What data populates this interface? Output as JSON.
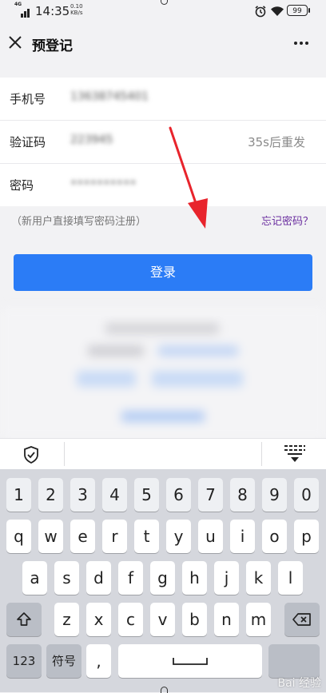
{
  "status_bar": {
    "network": "4G",
    "time": "14:35",
    "speed_value": "0.10",
    "speed_unit": "KB/s",
    "battery": "99"
  },
  "nav": {
    "title": "预登记",
    "close_icon": "close-icon",
    "more_icon": "more-icon"
  },
  "form": {
    "phone": {
      "label": "手机号",
      "value": "13638745401"
    },
    "code": {
      "label": "验证码",
      "value": "223945",
      "resend": "35s后重发"
    },
    "password": {
      "label": "密码",
      "value": "••••••••••"
    }
  },
  "hint": "（新用户直接填写密码注册）",
  "forgot": "忘记密码？",
  "login_button": "登录",
  "keyboard": {
    "numbers": [
      "1",
      "2",
      "3",
      "4",
      "5",
      "6",
      "7",
      "8",
      "9",
      "0"
    ],
    "row1": [
      "q",
      "w",
      "e",
      "r",
      "t",
      "y",
      "u",
      "i",
      "o",
      "p"
    ],
    "row2": [
      "a",
      "s",
      "d",
      "f",
      "g",
      "h",
      "j",
      "k",
      "l"
    ],
    "row3": [
      "z",
      "x",
      "c",
      "v",
      "b",
      "n",
      "m"
    ],
    "mode_123": "123",
    "symbols": "符号",
    "comma": ","
  },
  "watermark": "Bai 经验",
  "accent_color": "#2b7cf6",
  "link_color": "#6b2fa0",
  "annotation_color": "#e8242c"
}
